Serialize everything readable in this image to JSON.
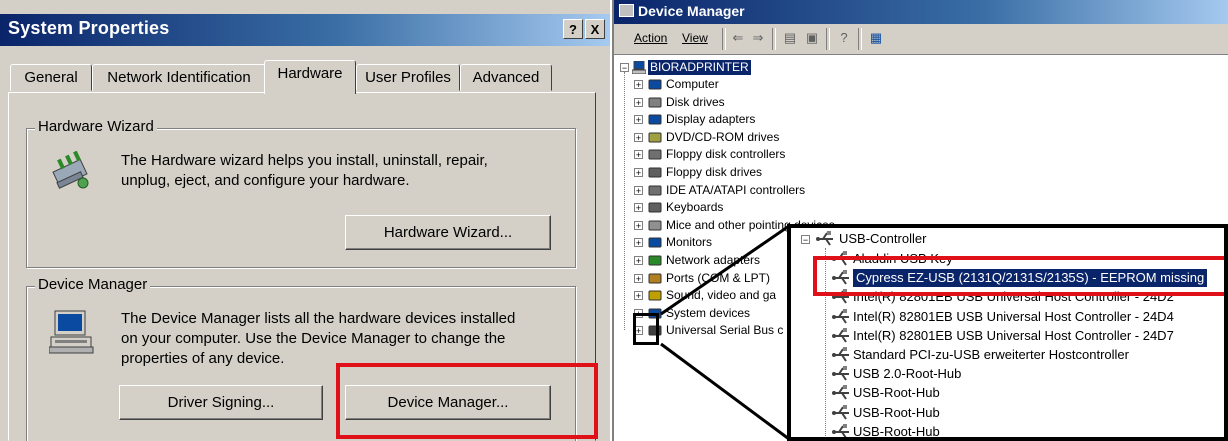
{
  "system_properties": {
    "title": "System Properties",
    "caption_help": "?",
    "caption_close": "X",
    "tabs": [
      {
        "label": "General",
        "active": false
      },
      {
        "label": "Network Identification",
        "active": false
      },
      {
        "label": "Hardware",
        "active": true
      },
      {
        "label": "User Profiles",
        "active": false
      },
      {
        "label": "Advanced",
        "active": false
      }
    ],
    "hardware_wizard": {
      "group_title": "Hardware Wizard",
      "description_line1": "The Hardware wizard helps you install, uninstall, repair,",
      "description_line2": "unplug, eject, and configure your hardware.",
      "button_label": "Hardware Wizard...",
      "icon": "hardware-wizard-icon"
    },
    "device_manager": {
      "group_title": "Device Manager",
      "description_line1": "The Device Manager lists all the hardware devices installed",
      "description_line2": "on your computer. Use the Device Manager to change the",
      "description_line3": "properties of any device.",
      "driver_signing_label": "Driver Signing...",
      "device_manager_label": "Device Manager...",
      "icon": "computer-icon"
    },
    "highlight_color": "#e01018"
  },
  "device_manager_window": {
    "title": "Device Manager",
    "menu": {
      "action": "Action",
      "view": "View"
    },
    "root": "BIORADPRINTER",
    "categories": [
      {
        "label": "Computer",
        "icon": "computer-icon"
      },
      {
        "label": "Disk drives",
        "icon": "disk-drive-icon"
      },
      {
        "label": "Display adapters",
        "icon": "monitor-icon"
      },
      {
        "label": "DVD/CD-ROM drives",
        "icon": "cdrom-icon"
      },
      {
        "label": "Floppy disk controllers",
        "icon": "controller-icon"
      },
      {
        "label": "Floppy disk drives",
        "icon": "floppy-icon"
      },
      {
        "label": "IDE ATA/ATAPI controllers",
        "icon": "controller-icon"
      },
      {
        "label": "Keyboards",
        "icon": "keyboard-icon"
      },
      {
        "label": "Mice and other pointing devices",
        "icon": "mouse-icon"
      },
      {
        "label": "Monitors",
        "icon": "monitor-icon"
      },
      {
        "label": "Network adapters",
        "icon": "network-icon"
      },
      {
        "label": "Ports (COM & LPT)",
        "icon": "port-icon"
      },
      {
        "label": "Sound, video and ga",
        "icon": "sound-icon"
      },
      {
        "label": "System devices",
        "icon": "system-icon"
      },
      {
        "label": "Universal Serial Bus c",
        "icon": "usb-icon"
      }
    ],
    "usb_zoom": {
      "header": "USB-Controller",
      "items": [
        {
          "label": "Aladdin USB Key",
          "selected": false
        },
        {
          "label": "Cypress EZ-USB (2131Q/2131S/2135S) - EEPROM missing",
          "selected": true
        },
        {
          "label": "Intel(R) 82801EB USB Universal Host Controller - 24D2",
          "selected": false
        },
        {
          "label": "Intel(R) 82801EB USB Universal Host Controller - 24D4",
          "selected": false
        },
        {
          "label": "Intel(R) 82801EB USB Universal Host Controller - 24D7",
          "selected": false
        },
        {
          "label": "Standard PCI-zu-USB erweiterter Hostcontroller",
          "selected": false
        },
        {
          "label": "USB 2.0-Root-Hub",
          "selected": false
        },
        {
          "label": "USB-Root-Hub",
          "selected": false
        },
        {
          "label": "USB-Root-Hub",
          "selected": false
        },
        {
          "label": "USB-Root-Hub",
          "selected": false
        }
      ]
    }
  }
}
